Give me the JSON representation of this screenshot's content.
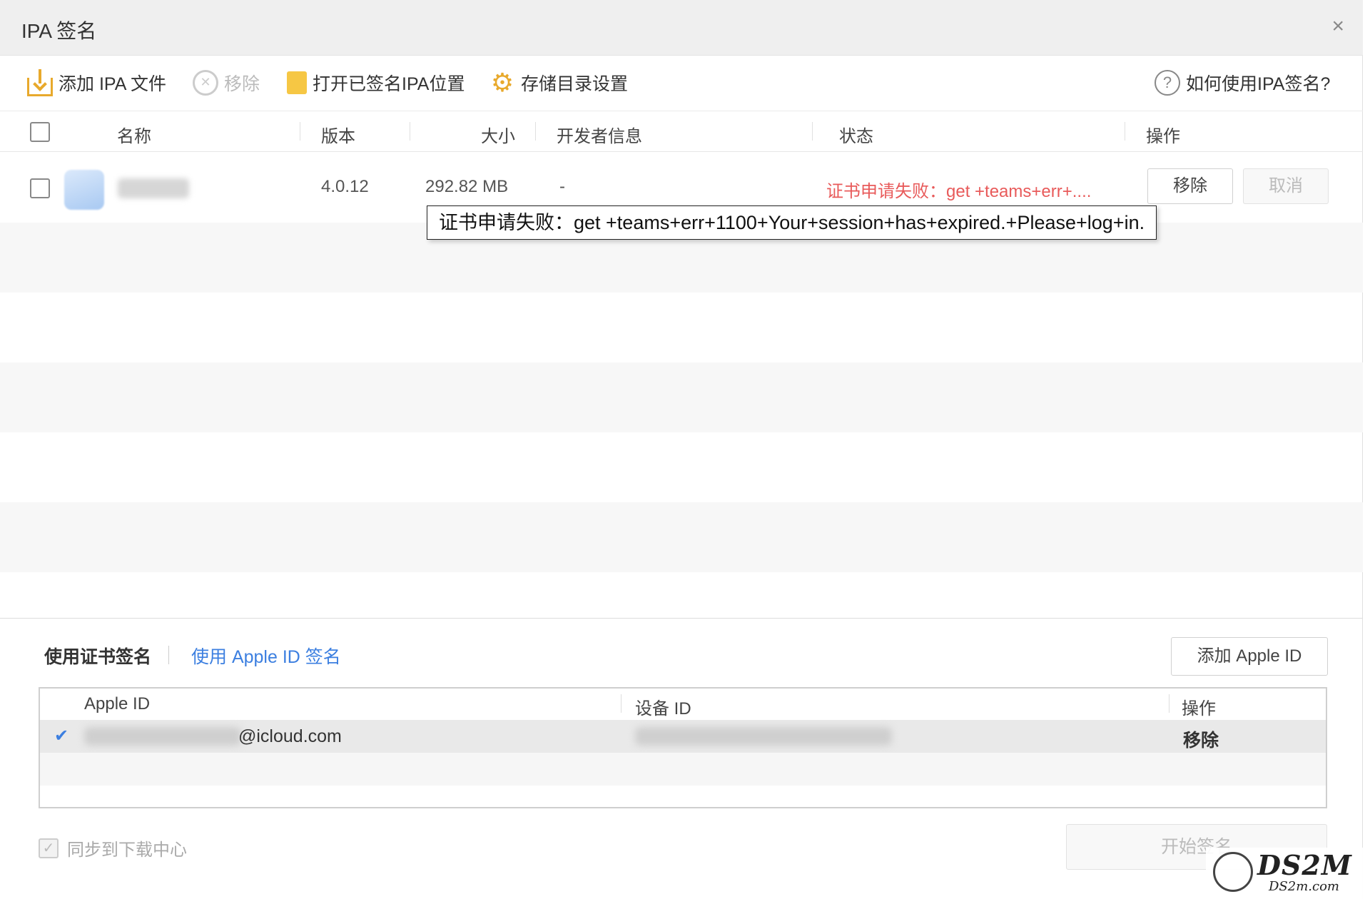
{
  "window": {
    "title": "IPA 签名",
    "close": "×"
  },
  "toolbar": {
    "add": "添加 IPA 文件",
    "remove": "移除",
    "open_folder": "打开已签名IPA位置",
    "storage": "存储目录设置",
    "help": "如何使用IPA签名?",
    "help_glyph": "?",
    "remove_glyph": "✕",
    "gear_glyph": "⚙"
  },
  "table": {
    "headers": {
      "name": "名称",
      "version": "版本",
      "size": "大小",
      "developer": "开发者信息",
      "status": "状态",
      "actions": "操作"
    },
    "rows": [
      {
        "version": "4.0.12",
        "size": "292.82 MB",
        "developer": "-",
        "status": "证书申请失败：get +teams+err+....",
        "remove": "移除",
        "cancel": "取消"
      }
    ]
  },
  "tooltip": "证书申请失败：get +teams+err+1100+Your+session+has+expired.+Please+log+in.",
  "bottom": {
    "tab_cert": "使用证书签名",
    "tab_apple": "使用 Apple ID 签名",
    "add_apple_id": "添加 Apple ID",
    "columns": {
      "apple_id": "Apple ID",
      "device_id": "设备 ID",
      "actions": "操作"
    },
    "accounts": [
      {
        "check": "✔",
        "email_suffix": "@icloud.com",
        "action": "移除"
      }
    ],
    "sync": "同步到下载中心",
    "sync_check": "✓",
    "start": "开始签名"
  },
  "watermark": {
    "big": "DS2M",
    "small": "DS2m.com"
  },
  "colors": {
    "accent": "#3c7fe0",
    "error": "#e85a5a",
    "icon": "#e8a92c"
  }
}
